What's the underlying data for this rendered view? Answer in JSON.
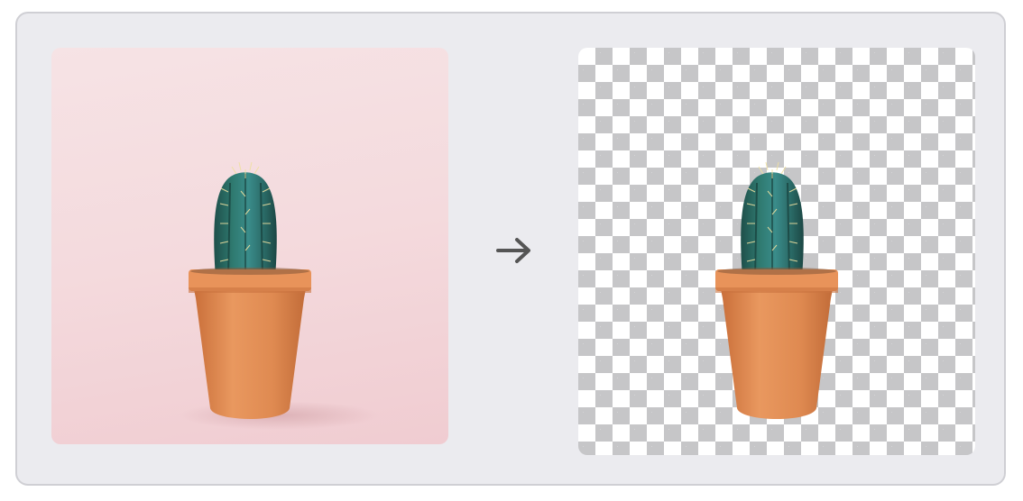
{
  "comparison": {
    "before_image": "cactus-in-pot-pink-background",
    "after_image": "cactus-in-pot-transparent-background",
    "arrow_icon": "arrow-right-icon"
  },
  "colors": {
    "card_background": "#ebebef",
    "card_border": "#cfcfd4",
    "original_background": "#f4dadd",
    "checker_dark": "#c6c6c8",
    "checker_light": "#ffffff",
    "pot": "#df8a51",
    "cactus": "#2f6f6a",
    "arrow": "#555555"
  }
}
